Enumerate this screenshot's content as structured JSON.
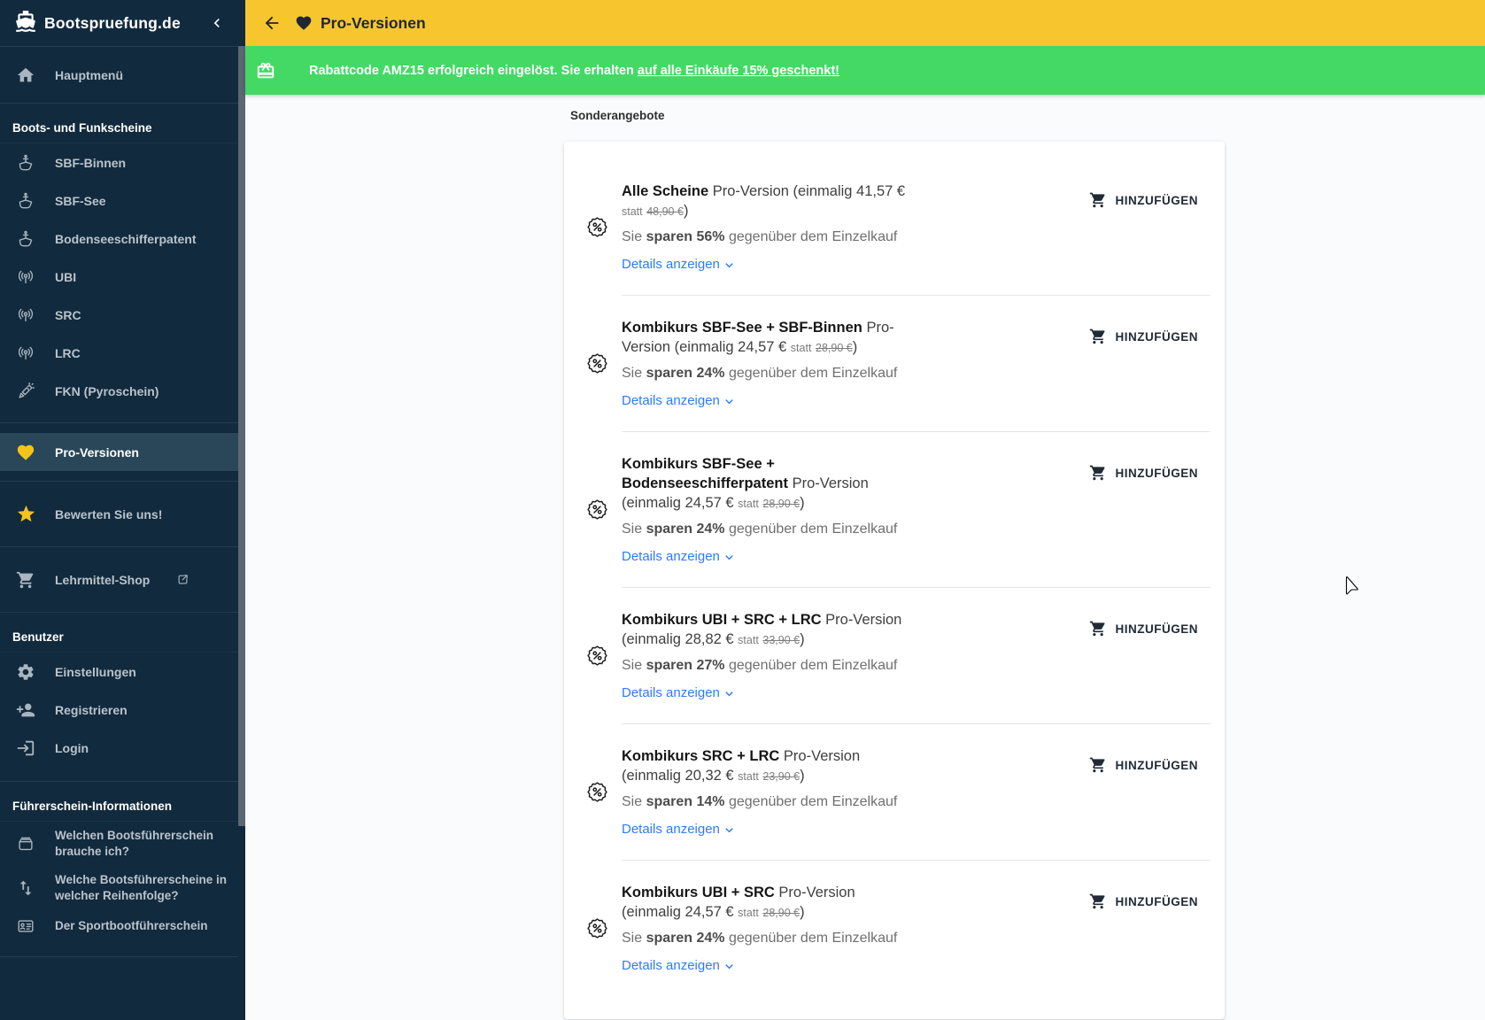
{
  "colors": {
    "sidebar_navy": "#122a3d",
    "sidebar_active": "#2a4759",
    "appbar_yellow": "#f7c62f",
    "banner_green": "#44d965",
    "accent_yellow_icon": "#f4c41c",
    "link_blue": "#2d7bf7"
  },
  "sidebar": {
    "brand": "Bootspruefung.de",
    "hauptmenu_label": "Hauptmenü",
    "group_boats": {
      "title": "Boots- und Funkscheine",
      "items": [
        {
          "label": "SBF-Binnen",
          "icon": "ship-icon"
        },
        {
          "label": "SBF-See",
          "icon": "ship-icon"
        },
        {
          "label": "Bodenseeschifferpatent",
          "icon": "ship-icon"
        },
        {
          "label": "UBI",
          "icon": "radio-antenna-icon"
        },
        {
          "label": "SRC",
          "icon": "radio-antenna-icon"
        },
        {
          "label": "LRC",
          "icon": "radio-antenna-icon"
        },
        {
          "label": "FKN (Pyroschein)",
          "icon": "firework-rocket-icon"
        }
      ]
    },
    "pro_versionen_label": "Pro-Versionen",
    "rate_us_label": "Bewerten Sie uns!",
    "shop_label": "Lehrmittel-Shop",
    "group_user": {
      "title": "Benutzer",
      "items": [
        {
          "label": "Einstellungen",
          "icon": "gear-icon"
        },
        {
          "label": "Registrieren",
          "icon": "person-add-icon"
        },
        {
          "label": "Login",
          "icon": "login-icon"
        }
      ]
    },
    "group_info": {
      "title": "Führerschein-Informationen",
      "items": [
        {
          "label": "Welchen Bootsführerschein brauche ich?",
          "icon": "box-icon"
        },
        {
          "label": "Welche Bootsführerscheine in welcher Reihenfolge?",
          "icon": "swap-vertical-icon"
        },
        {
          "label": "Der Sportbootführerschein",
          "icon": "id-card-icon"
        }
      ]
    }
  },
  "appbar": {
    "title": "Pro-Versionen"
  },
  "banner": {
    "text_before": "Rabattcode AMZ15 erfolgreich eingelöst. Sie erhalten",
    "text_underlined": "auf alle Einkäufe 15% geschenkt!"
  },
  "main": {
    "section_label": "Sonderangebote",
    "details_label": "Details anzeigen",
    "add_to_cart_label": "HINZUFÜGEN",
    "savings_prefix": "Sie",
    "savings_suffix": "gegenüber dem Einzelkauf",
    "statt_label": "statt",
    "close_paren": ")",
    "offers": [
      {
        "name": "Alle Scheine",
        "variant": "Pro-Version (einmalig 41,57 €",
        "old_price": "48,90 €",
        "savings_bold": "sparen 56%"
      },
      {
        "name": "Kombikurs SBF-See + SBF-Binnen",
        "variant": "Pro-Version (einmalig 24,57 €",
        "old_price": "28,90 €",
        "savings_bold": "sparen 24%"
      },
      {
        "name": "Kombikurs SBF-See + Bodenseeschifferpatent",
        "variant": "Pro-Version (einmalig 24,57 €",
        "old_price": "28,90 €",
        "savings_bold": "sparen 24%"
      },
      {
        "name": "Kombikurs UBI + SRC + LRC",
        "variant": "Pro-Version (einmalig 28,82 €",
        "old_price": "33,90 €",
        "savings_bold": "sparen 27%"
      },
      {
        "name": "Kombikurs SRC + LRC",
        "variant": "Pro-Version (einmalig 20,32 €",
        "old_price": "23,90 €",
        "savings_bold": "sparen 14%"
      },
      {
        "name": "Kombikurs UBI + SRC",
        "variant": "Pro-Version (einmalig 24,57 €",
        "old_price": "28,90 €",
        "savings_bold": "sparen 24%"
      }
    ]
  }
}
